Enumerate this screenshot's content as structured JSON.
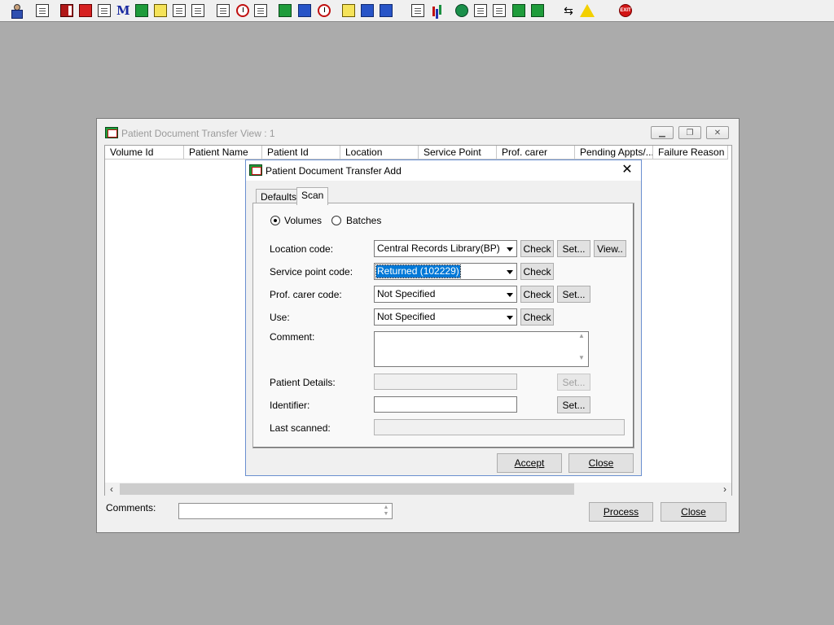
{
  "toolbar": {
    "icons": [
      "user-icon",
      "printer-icon",
      "book-icon",
      "edit-document-icon",
      "list-icon",
      "m-icon",
      "person-icon",
      "note-icon",
      "transfer-icon",
      "transfer-alt-icon",
      "envelope-icon",
      "clock-icon",
      "window-icon",
      "report-icon",
      "form-icon",
      "history-icon",
      "notes-icon",
      "bed-icon",
      "patient-list-icon",
      "blank-document-icon",
      "bar-chart-icon",
      "globe-icon",
      "document-check-icon",
      "document-arrow-icon",
      "document-green-icon",
      "document-flow-icon",
      "swap-icon",
      "warning-icon",
      "exit-icon"
    ],
    "exit_label": "EXIT"
  },
  "mdi_window": {
    "title": "Patient Document Transfer View : 1",
    "columns": [
      "Volume Id",
      "Patient Name",
      "Patient Id",
      "Location",
      "Service Point",
      "Prof. carer",
      "Pending Appts/...",
      "Failure Reason"
    ],
    "comments_label": "Comments:",
    "comments_value": "",
    "process_label": "Process",
    "close_label": "Close"
  },
  "dialog": {
    "title": "Patient Document Transfer Add",
    "tabs": [
      {
        "label": "Defaults",
        "active": false
      },
      {
        "label": "Scan",
        "active": true
      }
    ],
    "radio_volumes": "Volumes",
    "radio_batches": "Batches",
    "selected_mode": "Volumes",
    "location_label": "Location code:",
    "location_value": "Central Records Library(BP)",
    "service_point_label": "Service point code:",
    "service_point_value": "Returned (102229)",
    "prof_carer_label": "Prof. carer code:",
    "prof_carer_value": "Not Specified",
    "use_label": "Use:",
    "use_value": "Not Specified",
    "comment_label": "Comment:",
    "comment_value": "",
    "patient_details_label": "Patient Details:",
    "patient_details_value": "",
    "identifier_label": "Identifier:",
    "identifier_value": "",
    "last_scanned_label": "Last scanned:",
    "last_scanned_value": "",
    "check_label": "Check",
    "set_label": "Set...",
    "view_label": "View..",
    "accept_label": "Accept",
    "close_label": "Close"
  }
}
